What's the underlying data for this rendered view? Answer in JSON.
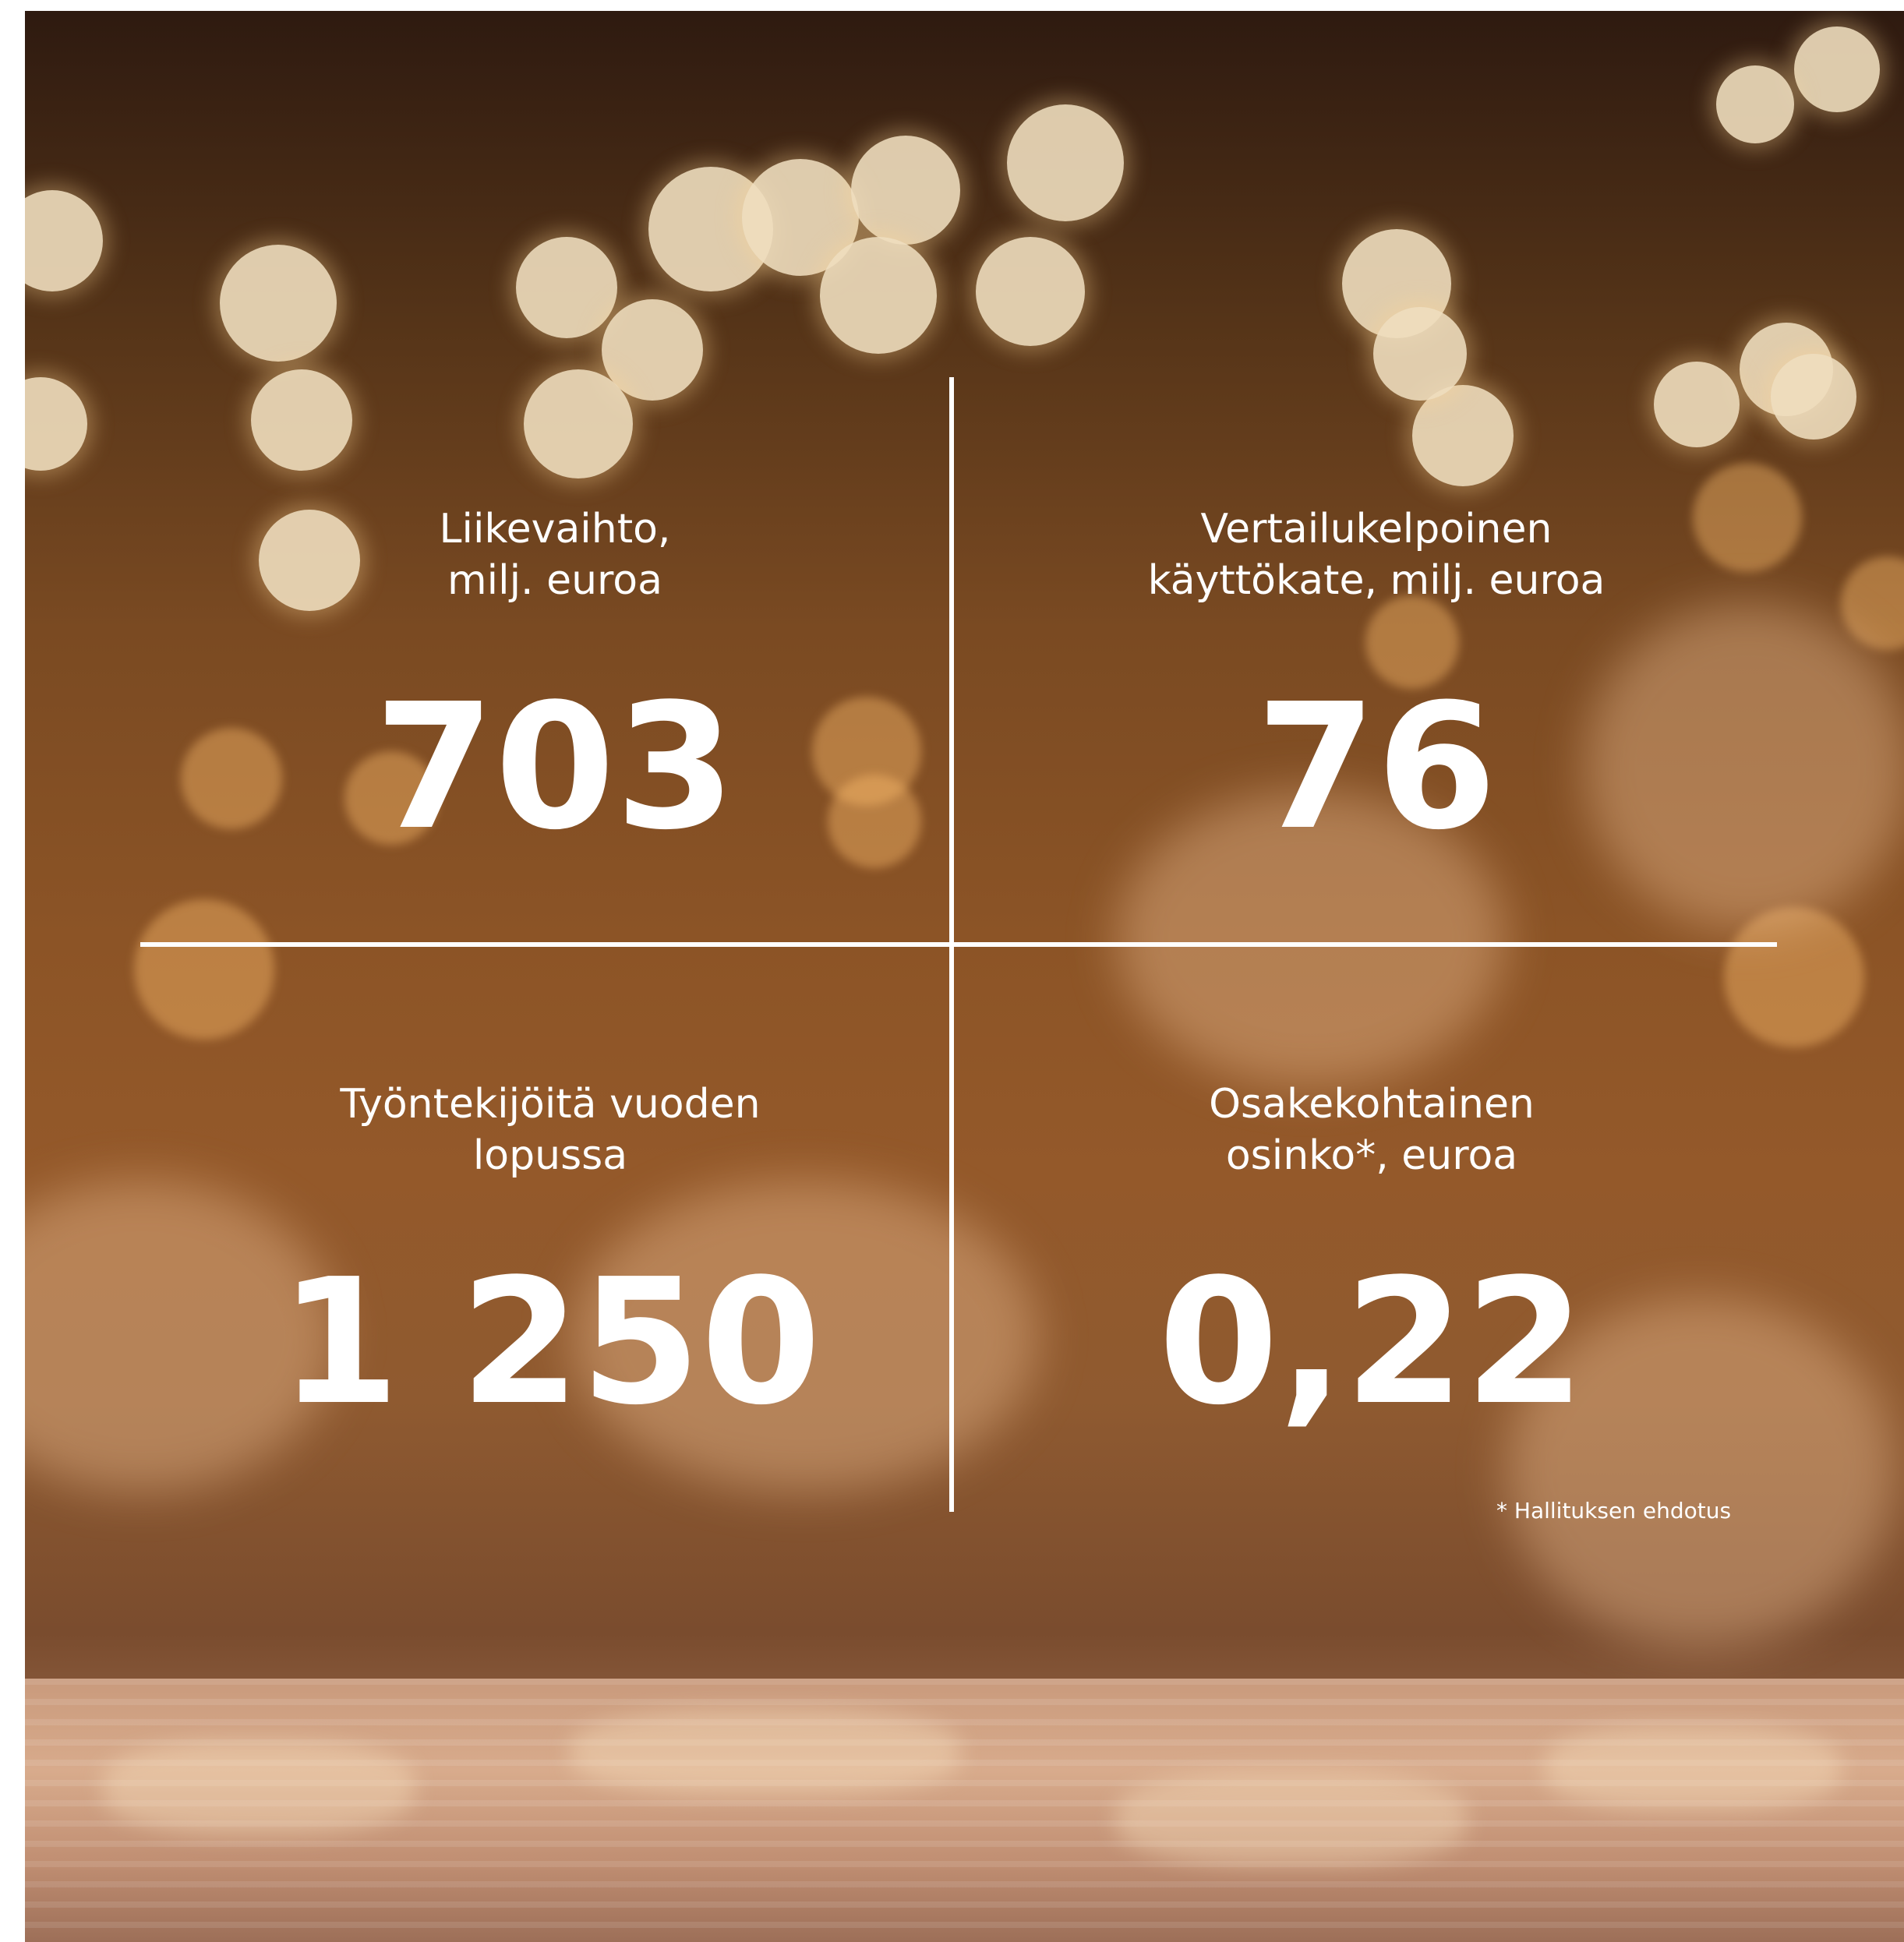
{
  "stats": [
    {
      "label": "Liikevaihto,\nmilj. euroa",
      "value": "703"
    },
    {
      "label": "Vertailukelpoinen\nkäyttökate, milj. euroa",
      "value": "76"
    },
    {
      "label": "Työntekijöitä vuoden\nlopussa",
      "value": "1 250"
    },
    {
      "label": "Osakekohtainen\nosinko*, euroa",
      "value": "0,22"
    }
  ],
  "footnote": "* Hallituksen ehdotus",
  "colors": {
    "text": "#ffffff",
    "divider": "#ffffff"
  }
}
